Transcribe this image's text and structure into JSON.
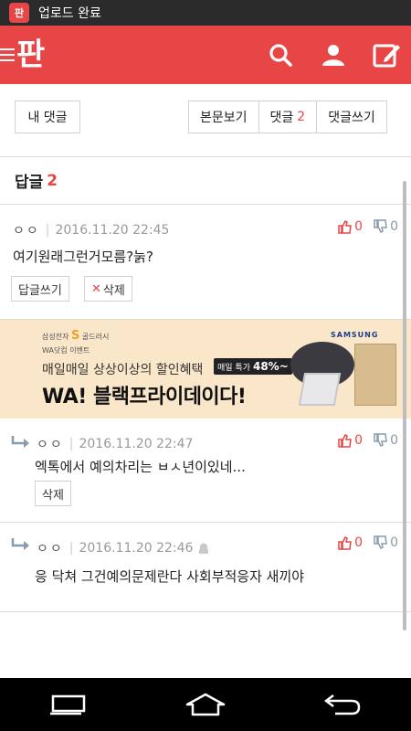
{
  "status_bar": {
    "app_icon_text": "판",
    "notification_text": "업로드 완료"
  },
  "app_bar": {
    "logo_text": "판",
    "colors": {
      "brand": "#e84546"
    },
    "icons": [
      "menu-icon",
      "search-icon",
      "user-icon",
      "edit-icon"
    ]
  },
  "toolbar": {
    "my_comments_label": "내 댓글",
    "view_article_label": "본문보기",
    "comments_label": "댓글",
    "comments_count": "2",
    "write_comment_label": "댓글쓰기"
  },
  "section": {
    "title": "답글",
    "count": "2"
  },
  "comments": [
    {
      "author": "ㅇㅇ",
      "timestamp": "2016.11.20 22:45",
      "text": "여기원래그런거모름?눍?",
      "up": "0",
      "down": "0",
      "reply_button_label": "답글쓰기",
      "delete_button_label": "삭제"
    },
    {
      "author": "ㅇㅇ",
      "timestamp": "2016.11.20 22:47",
      "text": "엑톡에서 예의차리는 ㅂㅅ년이있네...",
      "up": "0",
      "down": "0",
      "delete_button_label": "삭제"
    },
    {
      "author": "ㅇㅇ",
      "timestamp": "2016.11.20 22:46",
      "text": "응 닥쳐 그건예의문제란다 사회부적응자 새끼야",
      "up": "0",
      "down": "0"
    }
  ],
  "ad": {
    "brand": "삼성전자",
    "brand_highlight": "S",
    "brand_suffix": "골드러시",
    "event": "WA닷컴 이벤트",
    "line1": "매일매일 상상이상의 할인혜택",
    "line2": "WA! 블랙프라이데이다!",
    "discount_prefix": "매일 특가",
    "discount_value": "48%~",
    "samsung_logo": "SAMSUNG"
  }
}
